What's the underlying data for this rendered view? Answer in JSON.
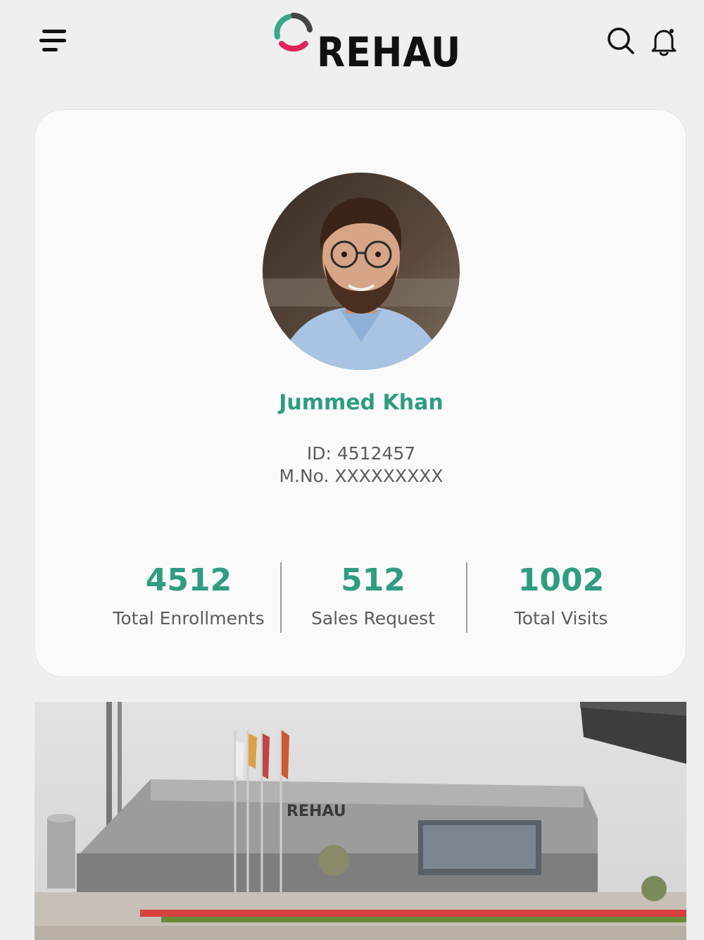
{
  "header": {
    "brand": "REHAU",
    "menu_icon": "menu-icon",
    "search_icon": "search-icon",
    "notification_icon": "bell-icon"
  },
  "profile": {
    "name": "Jummed Khan",
    "id_line": "ID: 4512457",
    "mobile_line": "M.No. XXXXXXXXX",
    "stats": [
      {
        "value": "4512",
        "label": "Total Enrollments"
      },
      {
        "value": "512",
        "label": "Sales Request"
      },
      {
        "value": "1002",
        "label": "Total Visits"
      }
    ]
  },
  "banner": {
    "sign_text": "REHAU"
  },
  "colors": {
    "accent": "#2f9c83",
    "background": "#efefef",
    "card": "#fafafa",
    "logo_green": "#3aa78a",
    "logo_pink": "#e0245e"
  }
}
